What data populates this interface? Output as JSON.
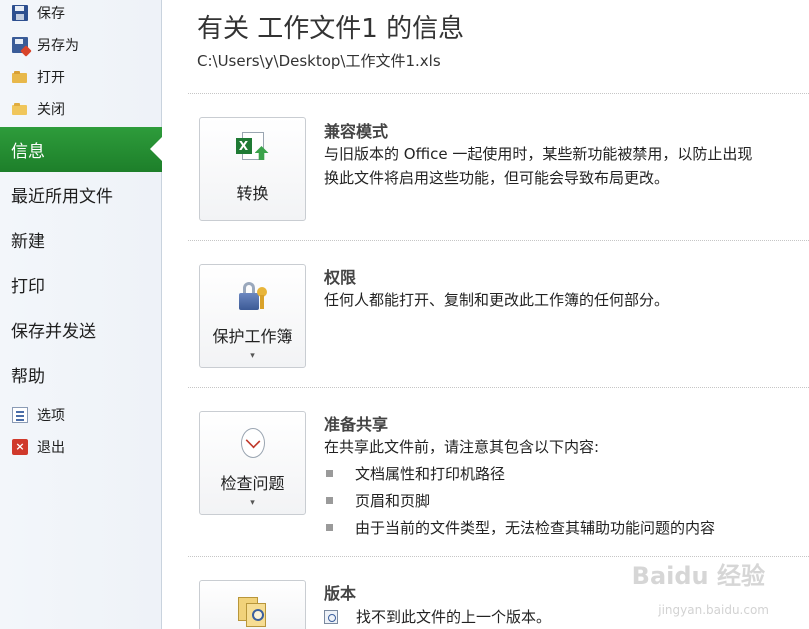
{
  "sidebar": {
    "small_items_top": [
      {
        "label": "保存",
        "icon": "save-icon"
      },
      {
        "label": "另存为",
        "icon": "save-as-icon"
      },
      {
        "label": "打开",
        "icon": "open-folder-icon"
      },
      {
        "label": "关闭",
        "icon": "close-folder-icon"
      }
    ],
    "big_items": [
      {
        "label": "信息",
        "active": true
      },
      {
        "label": "最近所用文件",
        "active": false
      },
      {
        "label": "新建",
        "active": false
      },
      {
        "label": "打印",
        "active": false
      },
      {
        "label": "保存并发送",
        "active": false
      },
      {
        "label": "帮助",
        "active": false
      }
    ],
    "small_items_bottom": [
      {
        "label": "选项",
        "icon": "options-icon"
      },
      {
        "label": "退出",
        "icon": "exit-icon"
      }
    ]
  },
  "main": {
    "title": "有关 工作文件1 的信息",
    "file_path": "C:\\Users\\y\\Desktop\\工作文件1.xls",
    "sections": [
      {
        "button_label": "转换",
        "button_icon": "excel-convert-icon",
        "heading": "兼容模式",
        "lines": [
          "与旧版本的 Office 一起使用时，某些新功能被禁用，以防止出现",
          "换此文件将启用这些功能，但可能会导致布局更改。"
        ]
      },
      {
        "button_label": "保护工作簿",
        "button_icon": "lock-key-icon",
        "heading": "权限",
        "lines": [
          "任何人都能打开、复制和更改此工作簿的任何部分。"
        ]
      },
      {
        "button_label": "检查问题",
        "button_icon": "inspect-document-icon",
        "heading": "准备共享",
        "lines": [
          "在共享此文件前，请注意其包含以下内容:"
        ],
        "bullets": [
          "文档属性和打印机路径",
          "页眉和页脚",
          "由于当前的文件类型，无法检查其辅助功能问题的内容"
        ]
      },
      {
        "button_label": "",
        "button_icon": "versions-icon",
        "heading": "版本",
        "lines": [
          "找不到此文件的上一个版本。"
        ]
      }
    ]
  },
  "watermark": {
    "text": "Baidu 经验",
    "sub": "jingyan.baidu.com"
  }
}
